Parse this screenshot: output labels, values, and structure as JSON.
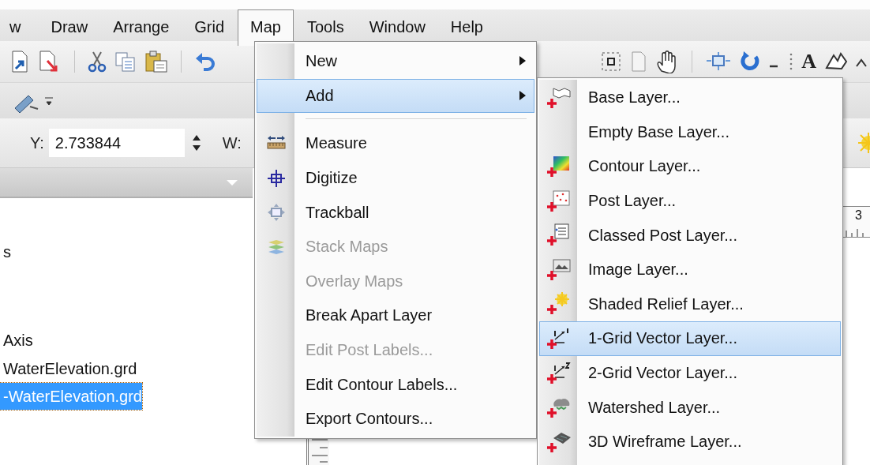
{
  "menu_bar": [
    {
      "label": "w",
      "selected": false
    },
    {
      "label": "Draw",
      "selected": false
    },
    {
      "label": "Arrange",
      "selected": false
    },
    {
      "label": "Grid",
      "selected": false
    },
    {
      "label": "Map",
      "selected": true
    },
    {
      "label": "Tools",
      "selected": false
    },
    {
      "label": "Window",
      "selected": false
    },
    {
      "label": "Help",
      "selected": false
    }
  ],
  "toolbar": {
    "text_tool": "A"
  },
  "property_bar": {
    "y_label": "Y:",
    "y_value": "2.733844",
    "w_label": "W:"
  },
  "object_tree": {
    "items": [
      {
        "label": "s",
        "selected": false
      },
      {
        "label": "Axis",
        "selected": false
      },
      {
        "label": "WaterElevation.grd",
        "selected": false
      },
      {
        "label": "-WaterElevation.grd",
        "selected": true
      }
    ]
  },
  "ruler": {
    "label": "3"
  },
  "map_menu": {
    "items": [
      {
        "kind": "item",
        "label": "New",
        "submenu": true,
        "selected": false,
        "disabled": false
      },
      {
        "kind": "item",
        "label": "Add",
        "submenu": true,
        "selected": true,
        "disabled": false
      },
      {
        "kind": "separator"
      },
      {
        "kind": "item",
        "label": "Measure",
        "submenu": false,
        "selected": false,
        "disabled": false
      },
      {
        "kind": "item",
        "label": "Digitize",
        "submenu": false,
        "selected": false,
        "disabled": false
      },
      {
        "kind": "item",
        "label": "Trackball",
        "submenu": false,
        "selected": false,
        "disabled": false
      },
      {
        "kind": "item",
        "label": "Stack Maps",
        "submenu": false,
        "selected": false,
        "disabled": true
      },
      {
        "kind": "item",
        "label": "Overlay Maps",
        "submenu": false,
        "selected": false,
        "disabled": true
      },
      {
        "kind": "item",
        "label": "Break Apart Layer",
        "submenu": false,
        "selected": false,
        "disabled": false
      },
      {
        "kind": "item",
        "label": "Edit Post Labels...",
        "submenu": false,
        "selected": false,
        "disabled": true
      },
      {
        "kind": "item",
        "label": "Edit Contour Labels...",
        "submenu": false,
        "selected": false,
        "disabled": false
      },
      {
        "kind": "item",
        "label": "Export Contours...",
        "submenu": false,
        "selected": false,
        "disabled": false
      }
    ]
  },
  "add_submenu": {
    "items": [
      {
        "label": "Base Layer...",
        "selected": false
      },
      {
        "label": "Empty Base Layer...",
        "selected": false
      },
      {
        "label": "Contour Layer...",
        "selected": false
      },
      {
        "label": "Post Layer...",
        "selected": false
      },
      {
        "label": "Classed Post Layer...",
        "selected": false
      },
      {
        "label": "Image Layer...",
        "selected": false
      },
      {
        "label": "Shaded Relief Layer...",
        "selected": false
      },
      {
        "label": "1-Grid Vector Layer...",
        "selected": true
      },
      {
        "label": "2-Grid Vector Layer...",
        "selected": false
      },
      {
        "label": "Watershed Layer...",
        "selected": false
      },
      {
        "label": "3D Wireframe Layer...",
        "selected": false
      }
    ]
  }
}
